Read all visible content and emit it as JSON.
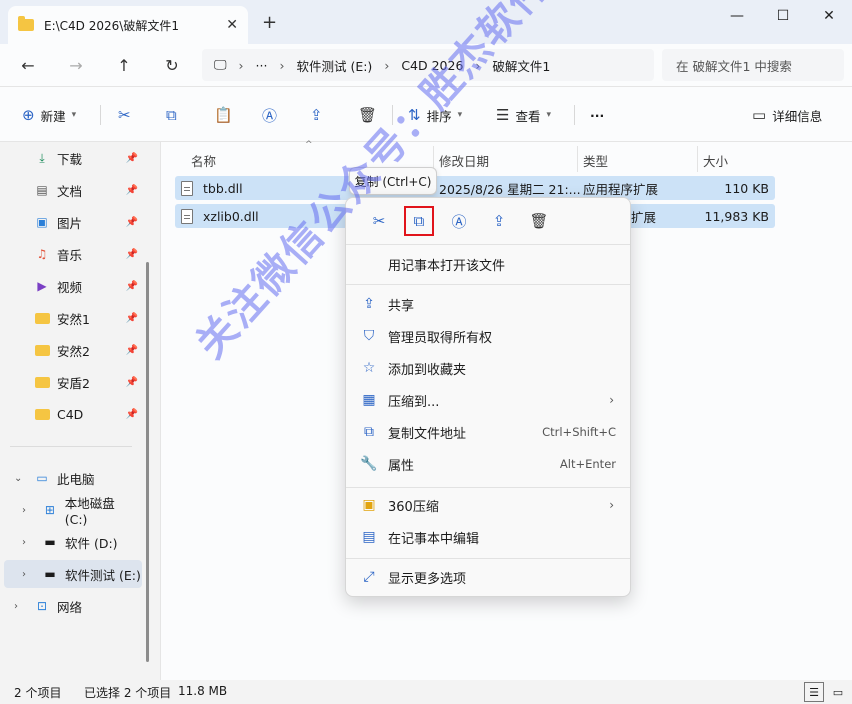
{
  "window": {
    "tab_title": "E:\\C4D 2026\\破解文件1",
    "close_symbol": "✕",
    "newtab_symbol": "+",
    "minimize": "—",
    "maximize": "☐",
    "close": "✕"
  },
  "address": {
    "more": "···",
    "segments": [
      "软件测试 (E:)",
      "C4D 2026",
      "破解文件1"
    ],
    "sep": "›"
  },
  "search": {
    "placeholder": "在 破解文件1 中搜索"
  },
  "toolbar": {
    "new_label": "新建",
    "sort_label": "排序",
    "view_label": "查看",
    "more": "···",
    "details_label": "详细信息"
  },
  "nav": {
    "items": [
      {
        "label": "下载",
        "icon": "download-icon"
      },
      {
        "label": "文档",
        "icon": "document-icon"
      },
      {
        "label": "图片",
        "icon": "pictures-icon"
      },
      {
        "label": "音乐",
        "icon": "music-icon"
      },
      {
        "label": "视频",
        "icon": "video-icon"
      },
      {
        "label": "安然1",
        "icon": "folder-icon"
      },
      {
        "label": "安然2",
        "icon": "folder-icon"
      },
      {
        "label": "安盾2",
        "icon": "folder-icon"
      },
      {
        "label": "C4D",
        "icon": "folder-icon"
      }
    ],
    "this_pc": "此电脑",
    "drives": [
      "本地磁盘 (C:)",
      "软件 (D:)",
      "软件测试 (E:)"
    ],
    "network": "网络"
  },
  "columns": {
    "name": "名称",
    "modified": "修改日期",
    "type": "类型",
    "size": "大小"
  },
  "files": [
    {
      "name": "tbb.dll",
      "modified": "2025/8/26 星期二 21:...",
      "type": "应用程序扩展",
      "size": "110 KB"
    },
    {
      "name": "xzlib0.dll",
      "modified": "",
      "type": "扩展",
      "size": "11,983 KB"
    }
  ],
  "tooltip": "复制 (Ctrl+C)",
  "context_menu": {
    "open_with_notepad": "用记事本打开该文件",
    "share": "共享",
    "take_ownership": "管理员取得所有权",
    "add_favorites": "添加到收藏夹",
    "compress_to": "压缩到...",
    "copy_path": "复制文件地址",
    "copy_path_shortcut": "Ctrl+Shift+C",
    "properties": "属性",
    "properties_shortcut": "Alt+Enter",
    "zip360": "360压缩",
    "edit_notepad": "在记事本中编辑",
    "more_options": "显示更多选项"
  },
  "status": {
    "items": "2 个项目",
    "selected": "已选择 2 个项目",
    "size": "11.8 MB"
  },
  "watermark": "关注微信公众号：胜杰软件管家",
  "colors": {
    "accent": "#2b64c5",
    "highlight": "#e1141b",
    "selection": "#cce2f7"
  }
}
